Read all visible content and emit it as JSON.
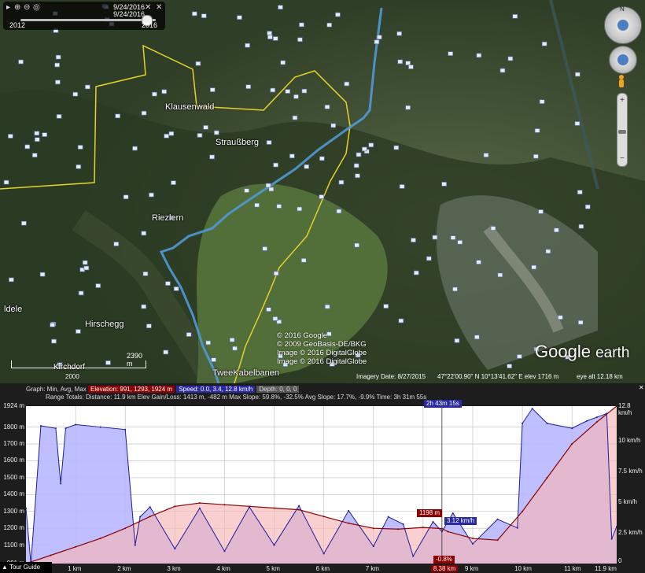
{
  "time_slider": {
    "date_top": "9/24/2016",
    "date_current": "9/24/2016",
    "start_year": "2012",
    "end_year": "2016"
  },
  "map": {
    "places": {
      "klausenwald": "Klausenwald",
      "straussberg": "Straußberg",
      "riezlern": "Riezlern",
      "hirschegg": "Hirschegg",
      "oldele": "ldele",
      "kirchdorf": "Kirchdorf",
      "tweekabelbanen": "TweeKabelbanen"
    },
    "credits": [
      "© 2016 Google",
      "© 2009 GeoBasis-DE/BKG",
      "Image © 2016 DigitalGlobe",
      "Image © 2016 DigitalGlobe"
    ],
    "scale_label": "2390 m",
    "year_2000": "2000",
    "imagery_date": "Imagery Date: 8/27/2015",
    "coords": "47°22'00.90\" N    10°13'41.62\" E  elev  1716 m",
    "eye_alt": "eye alt  12.18 km",
    "logo_google": "Google",
    "logo_earth": "earth",
    "compass_n": "N",
    "zoom_plus": "+",
    "zoom_minus": "−"
  },
  "profile": {
    "graph_prefix": "Graph: Min, Avg, Max",
    "elevation": "Elevation: 991, 1293, 1924 m",
    "speed": "Speed: 0.0, 3.4, 12.8 km/h",
    "depth": "Depth: 0, 0, 0",
    "range_totals": "Range Totals:  Distance: 11.9 km     Elev Gain/Loss: 1413 m, -482 m     Max Slope: 59.8%, -32.5%  Avg Slope: 17.7%, -9.9%     Time: 3h 31m 55s",
    "time_marker": "2h 43m 15s",
    "tooltip_elev": "1198 m",
    "tooltip_speed": "3.12 km/h",
    "tooltip_slope": "-0.8%",
    "cursor_km": "8.38 km",
    "tour_guide": "Tour Guide",
    "colors": {
      "elevation": "#8b0000",
      "speed": "#1c1c9c",
      "elev_fill": "#f6b5b5",
      "speed_fill": "#b8b8ff"
    }
  },
  "chart_data": {
    "type": "area",
    "title": "",
    "x_unit": "km",
    "xlim": [
      0,
      11.9
    ],
    "x_ticks": [
      "1 km",
      "2 km",
      "3 km",
      "4 km",
      "5 km",
      "6 km",
      "7 km",
      "8.38 km",
      "9 km",
      "10 km",
      "11 km",
      "11.9 km"
    ],
    "y_left_ticks": [
      "1924 m",
      "1800 m",
      "1700 m",
      "1600 m",
      "1500 m",
      "1400 m",
      "1300 m",
      "1200 m",
      "1100 m",
      "991 m"
    ],
    "y_right_ticks": [
      "12.8 km/h",
      "10 km/h",
      "7.5 km/h",
      "5 km/h",
      "2.5 km/h",
      "0"
    ],
    "ylim_left": [
      991,
      1924
    ],
    "ylim_right": [
      0,
      12.8
    ],
    "series": [
      {
        "name": "Elevation",
        "axis": "left",
        "x": [
          0,
          0.5,
          1,
          1.5,
          2,
          2.5,
          3,
          3.5,
          4,
          4.5,
          5,
          5.5,
          6,
          6.5,
          7,
          7.5,
          8,
          8.38,
          8.5,
          9,
          9.5,
          10,
          10.5,
          11,
          11.5,
          11.9
        ],
        "y": [
          991,
          1040,
          1090,
          1140,
          1200,
          1270,
          1330,
          1350,
          1340,
          1330,
          1320,
          1310,
          1270,
          1230,
          1200,
          1195,
          1205,
          1198,
          1180,
          1140,
          1130,
          1300,
          1500,
          1700,
          1830,
          1924
        ]
      },
      {
        "name": "Speed",
        "axis": "right",
        "x": [
          0,
          0.1,
          0.3,
          0.6,
          0.7,
          0.8,
          1.0,
          1.5,
          2.0,
          2.2,
          2.3,
          2.5,
          3,
          3.5,
          4,
          4.5,
          5,
          5.5,
          6,
          6.5,
          7,
          7.3,
          7.6,
          7.8,
          8.2,
          8.38,
          8.6,
          9,
          9.5,
          9.9,
          10,
          10.2,
          10.5,
          11,
          11.3,
          11.5,
          11.7,
          11.8,
          11.9
        ],
        "y": [
          4.5,
          0,
          11.2,
          11.0,
          6.5,
          11.0,
          11.3,
          11.1,
          10.9,
          1.5,
          3.8,
          4.6,
          1.2,
          4.5,
          1.0,
          4.6,
          1.5,
          4.7,
          0.8,
          4.3,
          1.4,
          3.8,
          3.2,
          0.6,
          3.4,
          2.6,
          4.1,
          1.6,
          3.6,
          2.9,
          11.4,
          12.6,
          11.4,
          11.0,
          11.6,
          11.9,
          12.2,
          2.0,
          3.0
        ]
      }
    ]
  }
}
